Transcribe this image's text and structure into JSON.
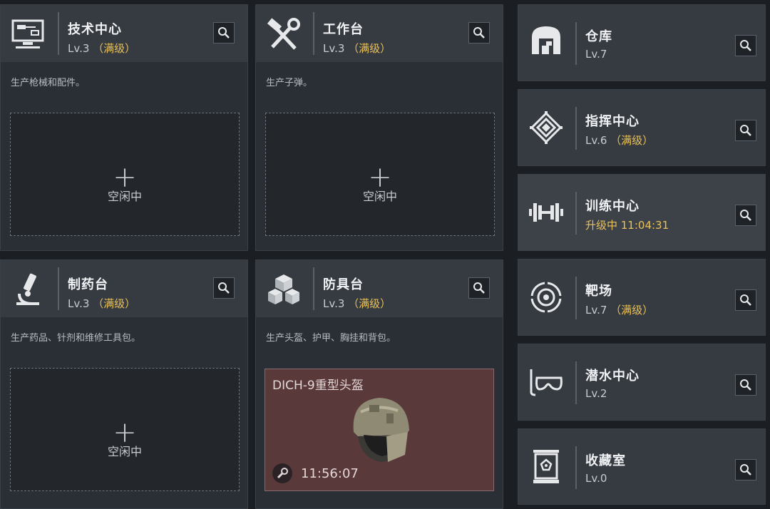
{
  "colors": {
    "max_level": "#e8c15a",
    "upgrading": "#e8c15a",
    "panel": "#2a2f35",
    "header": "#363b42",
    "craft_bg": "#5a393b"
  },
  "facilities": [
    {
      "title": "技术中心",
      "level": "Lv.3",
      "max_tag": "（满级）",
      "icon": "computer-icon",
      "description": "生产枪械和配件。",
      "slot_plus": "+",
      "slot_label": "空闲中"
    },
    {
      "title": "工作台",
      "level": "Lv.3",
      "max_tag": "（满级）",
      "icon": "hammer-wrench-icon",
      "description": "生产子弹。",
      "slot_plus": "+",
      "slot_label": "空闲中"
    },
    {
      "title": "制药台",
      "level": "Lv.3",
      "max_tag": "（满级）",
      "icon": "microscope-icon",
      "description": "生产药品、针剂和维修工具包。",
      "slot_plus": "+",
      "slot_label": "空闲中"
    },
    {
      "title": "防具台",
      "level": "Lv.3",
      "max_tag": "（满级）",
      "icon": "armor-blocks-icon",
      "description": "生产头盔、护甲、胸挂和背包。",
      "crafting": {
        "item_name": "DICH-9重型头盔",
        "timer": "11:56:07",
        "icon": "helmet-icon",
        "tool_icon": "wrench-icon"
      }
    }
  ],
  "side_facilities": [
    {
      "title": "仓库",
      "level": "Lv.7",
      "max_tag": "",
      "icon": "warehouse-icon"
    },
    {
      "title": "指挥中心",
      "level": "Lv.6",
      "max_tag": "（满级）",
      "icon": "command-pattern-icon"
    },
    {
      "title": "训练中心",
      "level": "升级中 11:04:31",
      "max_tag": "",
      "icon": "dumbbell-icon",
      "upgrading": true
    },
    {
      "title": "靶场",
      "level": "Lv.7",
      "max_tag": "（满级）",
      "icon": "target-icon"
    },
    {
      "title": "潜水中心",
      "level": "Lv.2",
      "max_tag": "",
      "icon": "diving-mask-icon"
    },
    {
      "title": "收藏室",
      "level": "Lv.0",
      "max_tag": "",
      "icon": "display-case-icon"
    }
  ]
}
